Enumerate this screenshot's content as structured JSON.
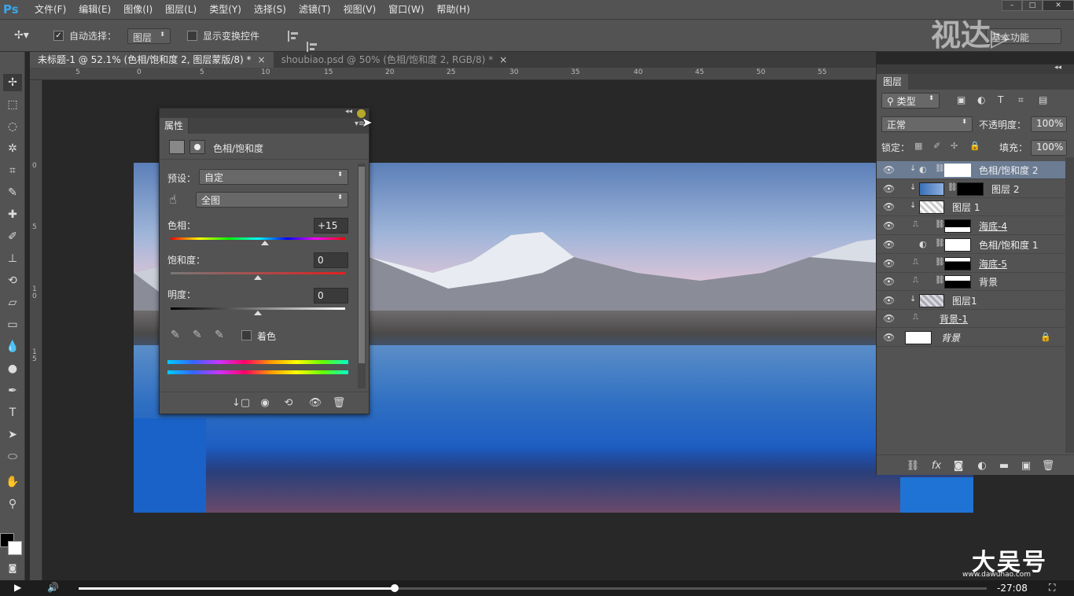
{
  "menubar": {
    "logo": "Ps",
    "items": [
      "文件(F)",
      "编辑(E)",
      "图像(I)",
      "图层(L)",
      "类型(Y)",
      "选择(S)",
      "滤镜(T)",
      "视图(V)",
      "窗口(W)",
      "帮助(H)"
    ]
  },
  "optionsbar": {
    "auto_select_label": "自动选择：",
    "auto_select_value": "图层",
    "show_transform_label": "显示变换控件",
    "workspace": "基本功能"
  },
  "tabs": [
    {
      "label": "未标题-1 @ 52.1% (色相/饱和度 2, 图层蒙版/8) *",
      "close": "×"
    },
    {
      "label": "shoubiao.psd @ 50% (色相/饱和度 2, RGB/8) *",
      "close": "×"
    }
  ],
  "ruler_top_ticks": [
    "5",
    "0",
    "5",
    "10",
    "15",
    "20",
    "25",
    "30",
    "35",
    "40",
    "45",
    "50",
    "55"
  ],
  "ruler_left_ticks": [
    "0",
    "5",
    "1\n0",
    "1\n5"
  ],
  "properties": {
    "tab": "属性",
    "type_title": "色相/饱和度",
    "preset_label": "预设：",
    "preset_value": "自定",
    "range_value": "全图",
    "hue_label": "色相：",
    "hue_value": "+15",
    "hue_level": 15,
    "saturation_label": "饱和度：",
    "saturation_value": "0",
    "saturation_level": 0,
    "lightness_label": "明度：",
    "lightness_value": "0",
    "lightness_level": 0,
    "colorize_label": "着色"
  },
  "layers": {
    "tab": "图层",
    "filter_type": "类型",
    "blend_mode": "正常",
    "opacity_label": "不透明度：",
    "opacity_value": "100%",
    "lock_label": "锁定：",
    "fill_label": "填充：",
    "fill_value": "100%",
    "items": [
      {
        "name": "色相/饱和度 2",
        "selected": true
      },
      {
        "name": "图层 2",
        "selected": false
      },
      {
        "name": "图层 1",
        "selected": false
      },
      {
        "name": "海底-4",
        "selected": false
      },
      {
        "name": "色相/饱和度 1",
        "selected": false
      },
      {
        "name": "海底-5",
        "selected": false
      },
      {
        "name": "背景",
        "selected": false
      },
      {
        "name": "图层1",
        "selected": false
      },
      {
        "name": "背景-1",
        "selected": false
      },
      {
        "name": "背景",
        "selected": false
      }
    ]
  },
  "video": {
    "time": "-27:08",
    "progress": 0.348
  },
  "watermark": {
    "top": "视达",
    "bottom": "大吴号",
    "url": "www.dawuhao.com"
  }
}
